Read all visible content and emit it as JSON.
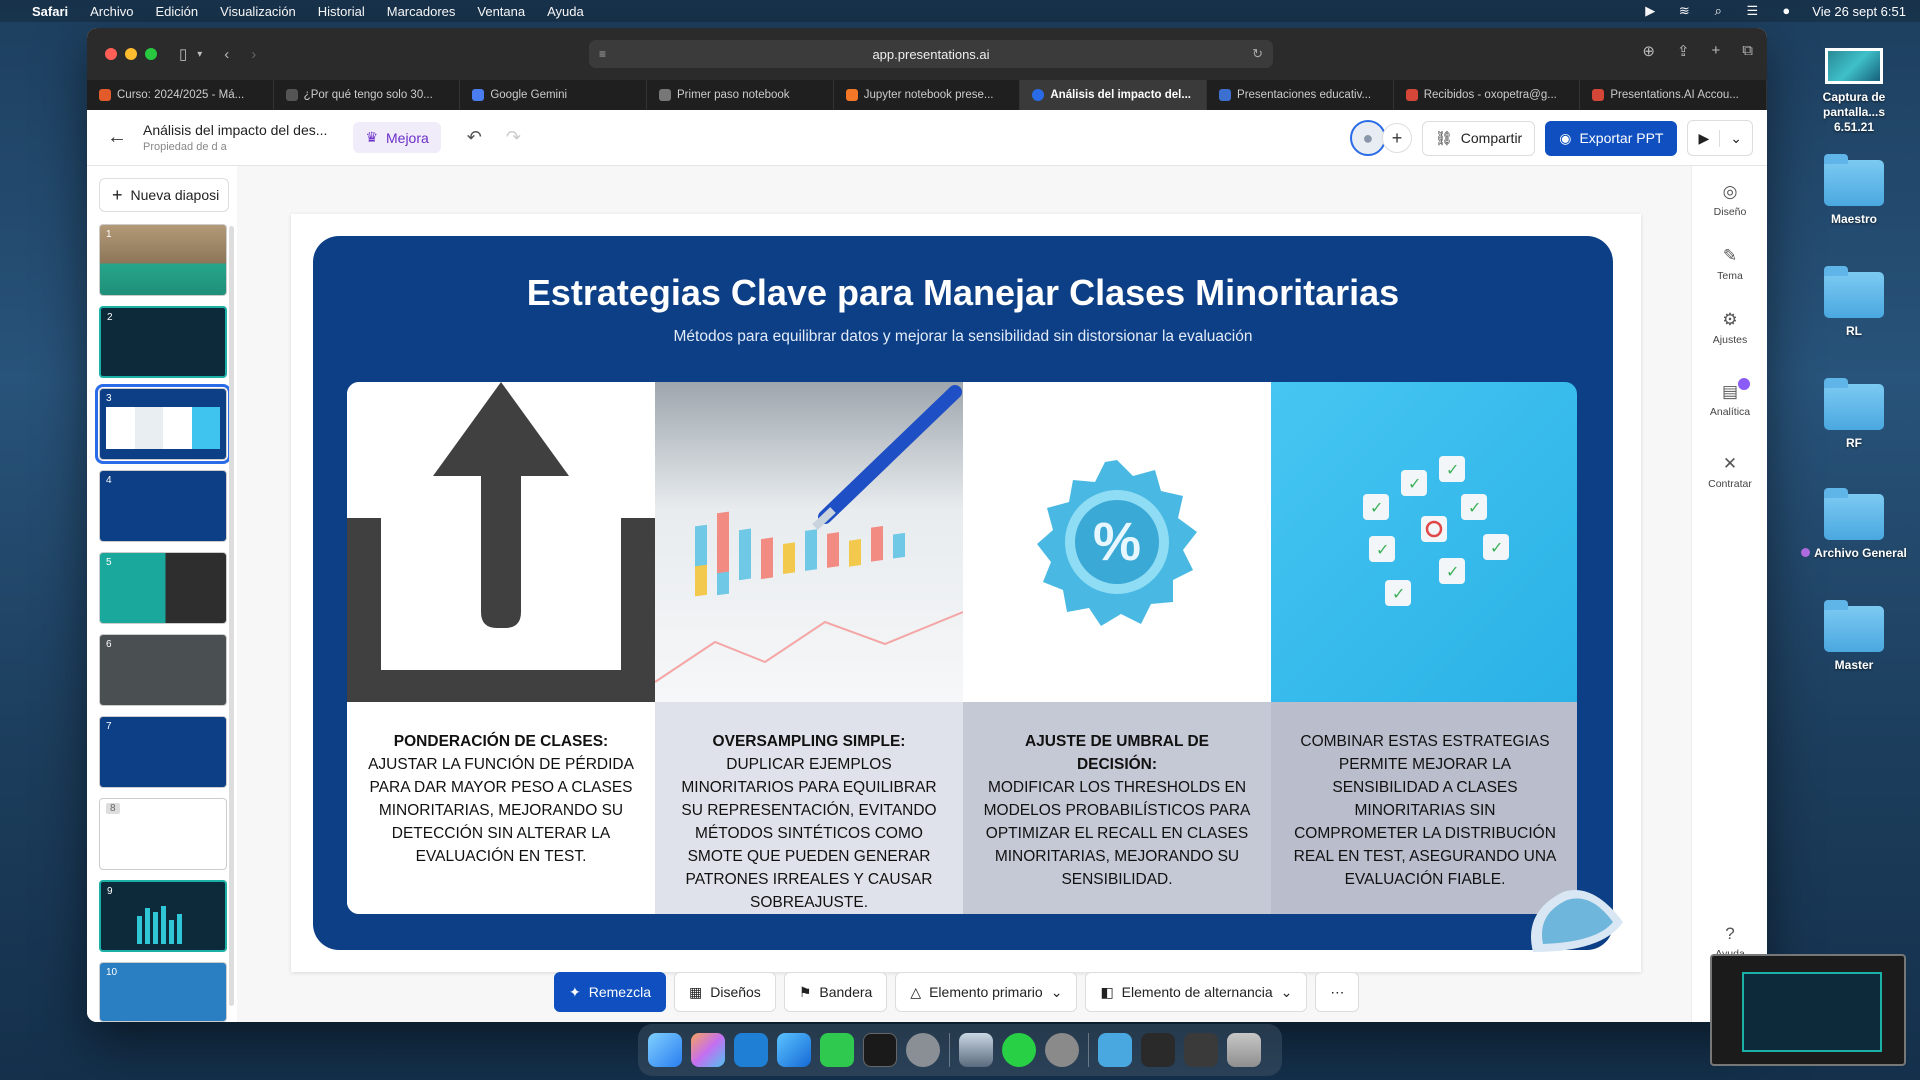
{
  "menubar": {
    "app": "Safari",
    "items": [
      "Archivo",
      "Edición",
      "Visualización",
      "Historial",
      "Marcadores",
      "Ventana",
      "Ayuda"
    ],
    "datetime": "Vie 26 sept 6:51"
  },
  "desktop": {
    "screenshot_label": "Captura de pantalla...s 6.51.21",
    "folders": [
      "Maestro",
      "RL",
      "RF",
      "Archivo General",
      "Master"
    ]
  },
  "browser": {
    "url": "app.presentations.ai",
    "tabs": [
      {
        "label": "Curso: 2024/2025 - Má...",
        "color": "#e35b2a"
      },
      {
        "label": "¿Por qué tengo solo 30...",
        "color": "#444444"
      },
      {
        "label": "Google Gemini",
        "color": "#4a7df0"
      },
      {
        "label": "Primer paso notebook",
        "color": "#777777"
      },
      {
        "label": "Jupyter notebook prese...",
        "color": "#f37726"
      },
      {
        "label": "Análisis del impacto del...",
        "color": "#2a6be8",
        "active": true
      },
      {
        "label": "Presentaciones educativ...",
        "color": "#3b6fd0"
      },
      {
        "label": "Recibidos - oxopetra@g...",
        "color": "#d44638"
      },
      {
        "label": "Presentations.AI Accou...",
        "color": "#d44638"
      }
    ]
  },
  "app": {
    "doc_title": "Análisis del impacto del des...",
    "doc_subtitle": "Propiedad de d a",
    "mejora_label": "Mejora",
    "share_label": "Compartir",
    "export_label": "Exportar PPT",
    "new_slide_label": "Nueva diaposi",
    "slide_numbers": [
      "1",
      "2",
      "3",
      "4",
      "5",
      "6",
      "7",
      "8",
      "9",
      "10"
    ],
    "selected_slide": 3,
    "tools": [
      "Diseño",
      "Tema",
      "Ajustes",
      "Analítica",
      "Contratar",
      "Ayuda"
    ],
    "bottom": {
      "remix": "Remezcla",
      "designs": "Diseños",
      "flag": "Bandera",
      "primary": "Elemento primario",
      "alt": "Elemento de alternancia"
    }
  },
  "slide": {
    "title": "Estrategias Clave para Manejar Clases Minoritarias",
    "subtitle": "Métodos para equilibrar datos y mejorar la sensibilidad sin distorsionar la evaluación",
    "columns": [
      {
        "heading": "PONDERACIÓN DE CLASES:",
        "body": "AJUSTAR LA FUNCIÓN DE PÉRDIDA PARA DAR MAYOR PESO A CLASES MINORITARIAS, MEJORANDO SU DETECCIÓN SIN ALTERAR LA EVALUACIÓN EN TEST.",
        "bg": "#ffffff"
      },
      {
        "heading": "OVERSAMPLING SIMPLE:",
        "body": "DUPLICAR EJEMPLOS MINORITARIOS PARA EQUILIBRAR SU REPRESENTACIÓN, EVITANDO MÉTODOS SINTÉTICOS COMO SMOTE QUE PUEDEN GENERAR PATRONES IRREALES Y CAUSAR SOBREAJUSTE.",
        "bg": "#dfe2ea"
      },
      {
        "heading": "AJUSTE DE UMBRAL DE DECISIÓN:",
        "body": "MODIFICAR LOS THRESHOLDS EN MODELOS PROBABILÍSTICOS PARA OPTIMIZAR EL RECALL EN CLASES MINORITARIAS, MEJORANDO SU SENSIBILIDAD.",
        "bg": "#c5c9d6"
      },
      {
        "heading": "",
        "body": "COMBINAR ESTAS ESTRATEGIAS PERMITE MEJORAR LA SENSIBILIDAD A CLASES MINORITARIAS SIN COMPROMETER LA DISTRIBUCIÓN REAL EN TEST, ASEGURANDO UNA EVALUACIÓN FIABLE.",
        "bg": "#b9bdcc"
      }
    ]
  }
}
